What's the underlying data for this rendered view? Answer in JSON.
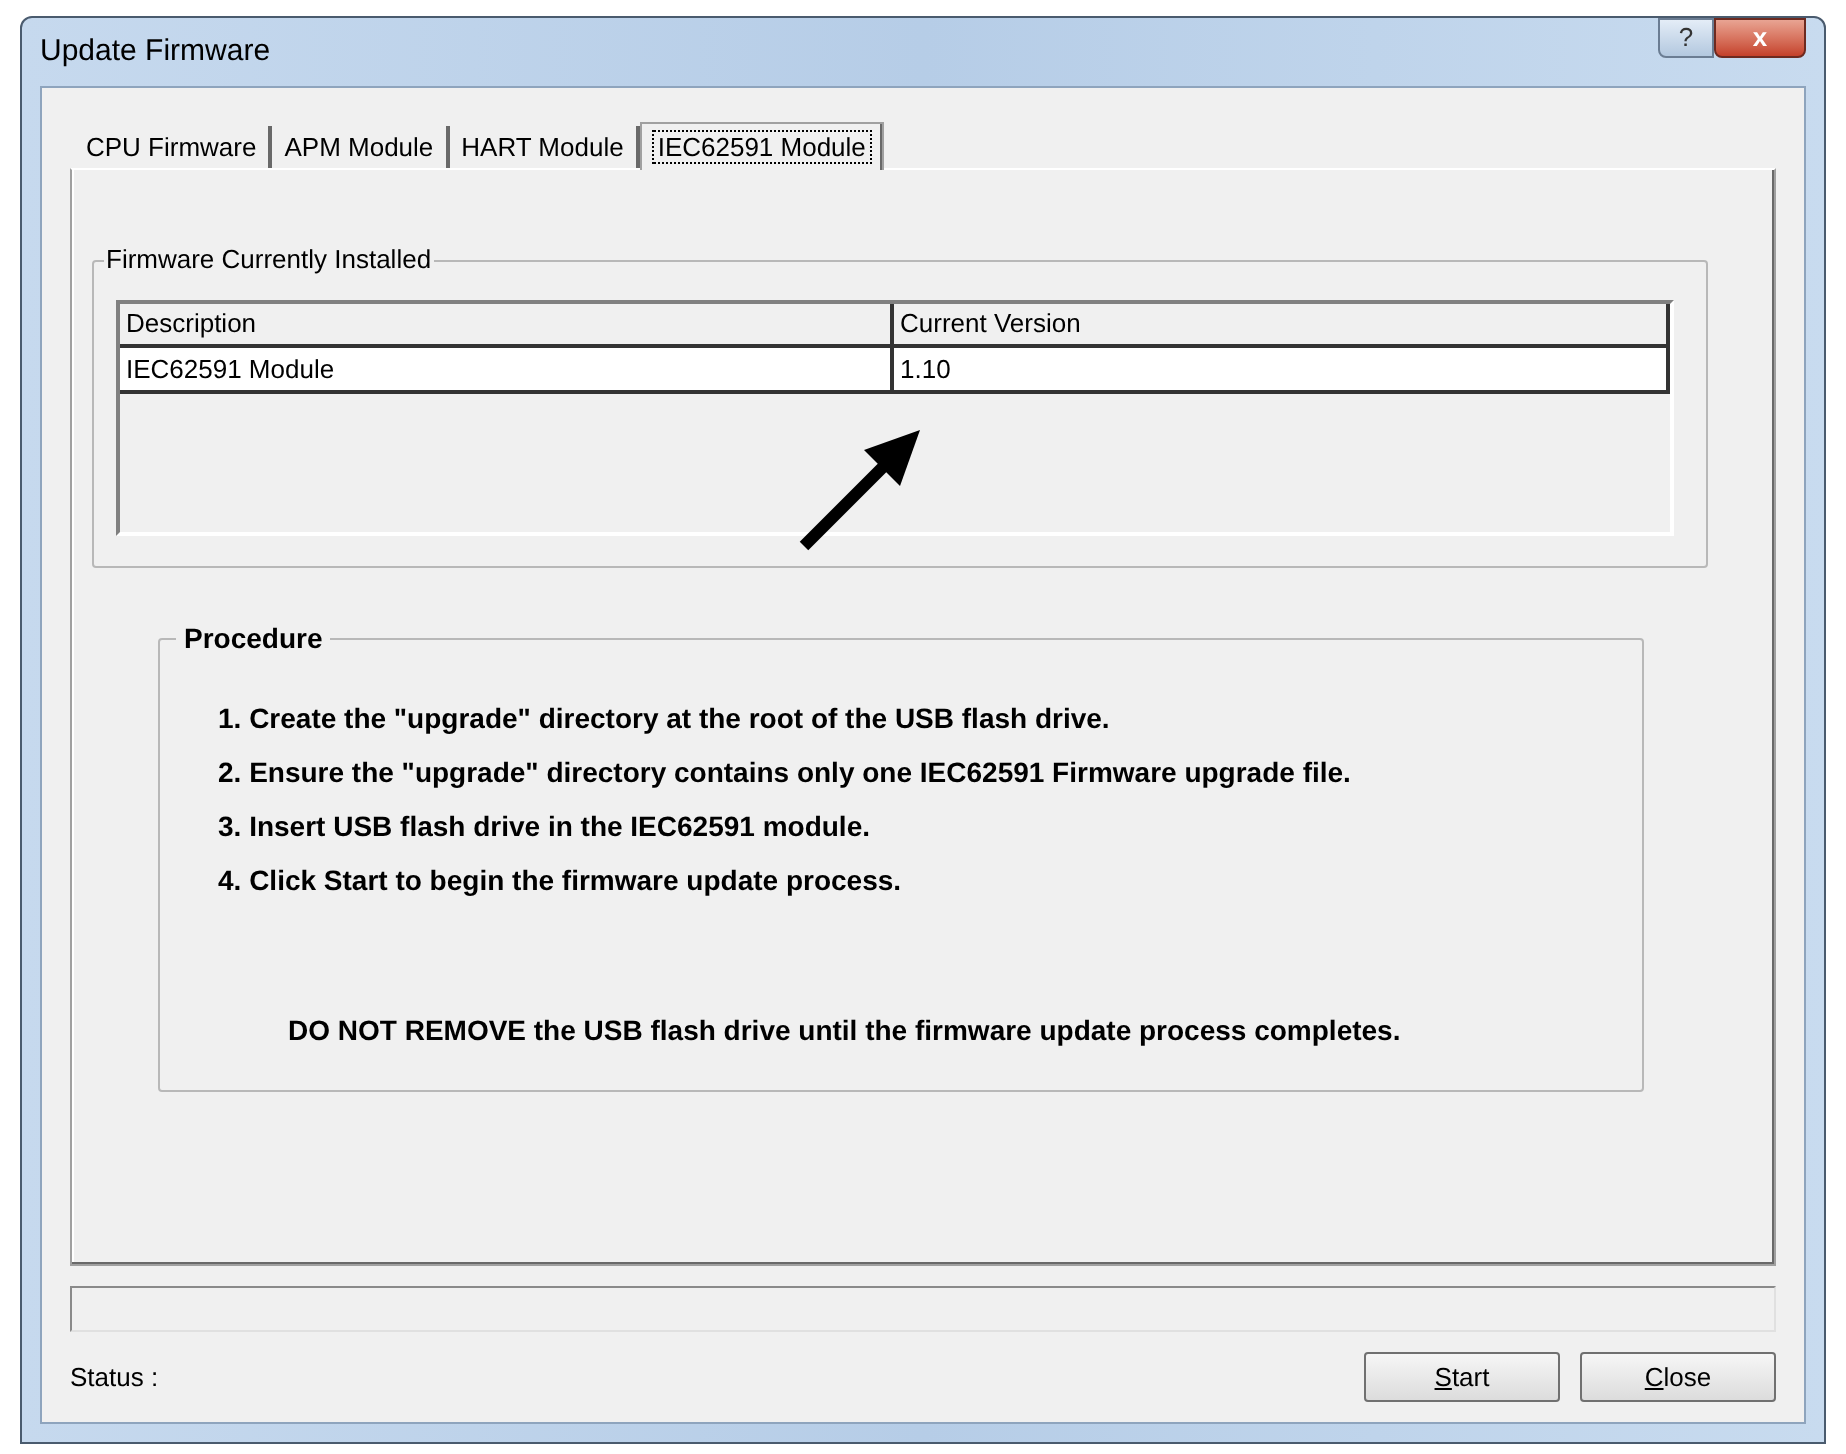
{
  "window": {
    "title": "Update Firmware",
    "buttons": [
      {
        "kind": "help",
        "label": "?"
      },
      {
        "kind": "close",
        "label": "x"
      }
    ]
  },
  "tabs": [
    {
      "label": "CPU Firmware",
      "selected": false
    },
    {
      "label": "APM Module",
      "selected": false
    },
    {
      "label": "HART Module",
      "selected": false
    },
    {
      "label": "IEC62591 Module",
      "selected": true
    }
  ],
  "installed": {
    "title": "Firmware Currently Installed",
    "columns": [
      "Description",
      "Current Version"
    ],
    "rows": [
      [
        "IEC62591 Module",
        "1.10"
      ]
    ]
  },
  "procedure": {
    "title": "Procedure",
    "steps": [
      "1. Create the \"upgrade\" directory at the root of the USB flash drive.",
      "2. Ensure the \"upgrade\" directory contains only one IEC62591 Firmware upgrade file.",
      "3. Insert USB flash drive in the IEC62591 module.",
      "4. Click Start to begin the firmware update process."
    ],
    "warning": "DO NOT REMOVE the USB flash drive until the firmware update process completes."
  },
  "progress": {
    "level": 0
  },
  "status_label": "Status :",
  "buttons": [
    {
      "label": "Start",
      "mnemonic_underlined": true
    },
    {
      "label": "Close",
      "mnemonic_underlined": true
    }
  ]
}
